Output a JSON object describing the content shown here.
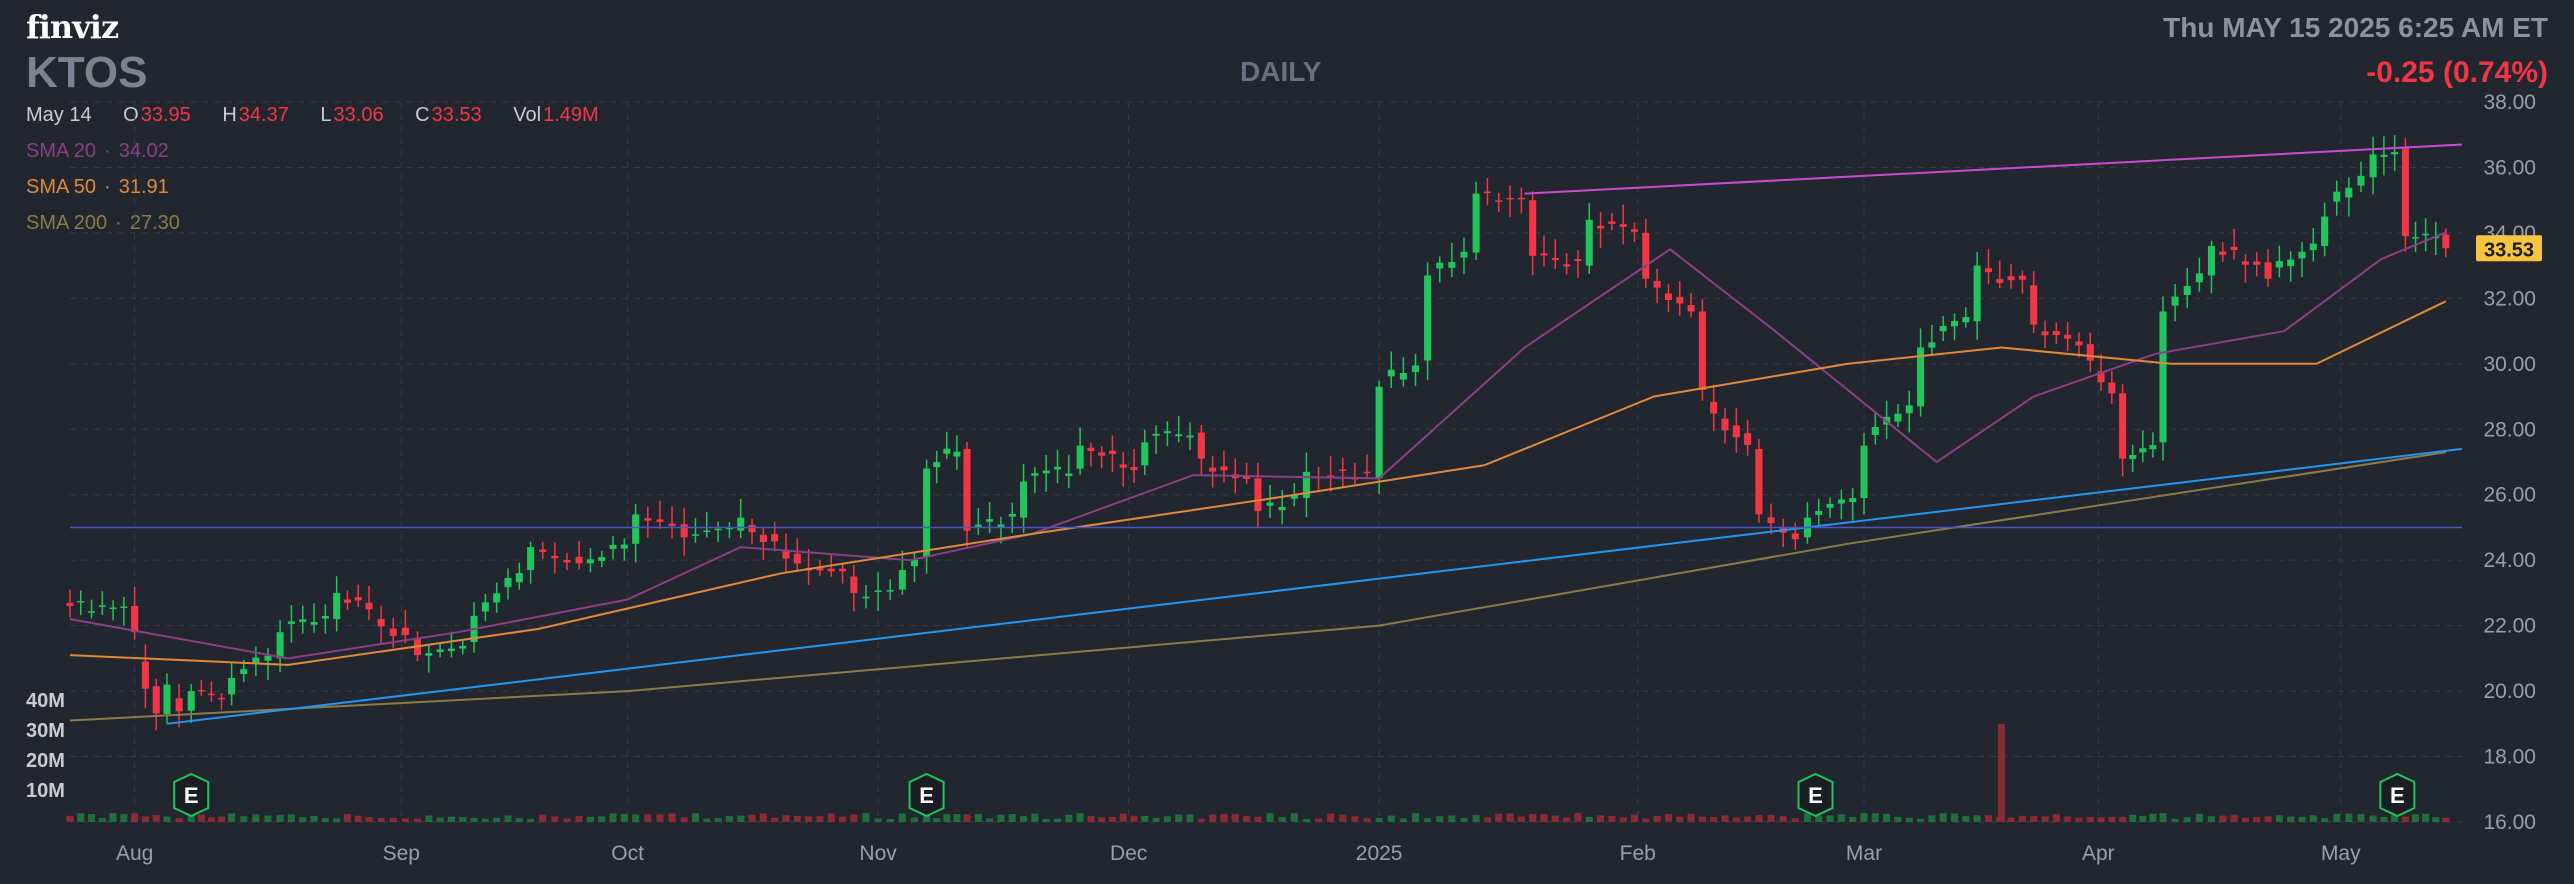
{
  "header": {
    "logo": "finviz",
    "ticker": "KTOS",
    "period": "DAILY",
    "datetime": "Thu MAY 15 2025 6:25 AM ET",
    "change": "-0.25 (0.74%)"
  },
  "ohlc": {
    "date": "May 14",
    "open_label": "O",
    "open": "33.95",
    "high_label": "H",
    "high": "34.37",
    "low_label": "L",
    "low": "33.06",
    "close_label": "C",
    "close": "33.53",
    "vol_label": "Vol",
    "vol": "1.49M"
  },
  "sma": [
    {
      "label": "SMA 20",
      "value": "34.02",
      "color": "#8a3f86"
    },
    {
      "label": "SMA 50",
      "value": "31.91",
      "color": "#e08a3a"
    },
    {
      "label": "SMA 200",
      "value": "27.30",
      "color": "#8c7a48"
    }
  ],
  "volume_axis": [
    "40M",
    "30M",
    "20M",
    "10M"
  ],
  "colors": {
    "up": "#21c45d",
    "down": "#f23645",
    "grid": "#363b46",
    "trend_upper": "#c94ad8",
    "trend_lower": "#2196f3",
    "hline": "#4c55c6",
    "price_tag_bg": "#f5c542",
    "axis_text": "#9aa0ab",
    "earnings": "#21c45d"
  },
  "chart_data": {
    "type": "candlestick",
    "ylim": [
      16,
      38
    ],
    "y_ticks": [
      "16.00",
      "18.00",
      "20.00",
      "22.00",
      "24.00",
      "26.00",
      "28.00",
      "30.00",
      "32.00",
      "34.00",
      "36.00",
      "38.00"
    ],
    "x_ticks": [
      {
        "label": "Aug",
        "date": "2024-08-01"
      },
      {
        "label": "Sep",
        "date": "2024-09-03"
      },
      {
        "label": "Oct",
        "date": "2024-10-01"
      },
      {
        "label": "Nov",
        "date": "2024-11-01"
      },
      {
        "label": "Dec",
        "date": "2024-12-02"
      },
      {
        "label": "2025",
        "date": "2025-01-02"
      },
      {
        "label": "Feb",
        "date": "2025-02-03"
      },
      {
        "label": "Mar",
        "date": "2025-03-03"
      },
      {
        "label": "Apr",
        "date": "2025-04-01"
      },
      {
        "label": "May",
        "date": "2025-05-01"
      }
    ],
    "last_price": "33.53",
    "earnings_label": "E",
    "earnings_dates": [
      "2024-08-08",
      "2024-11-07",
      "2025-02-25",
      "2025-05-08"
    ],
    "candles": [
      [
        "2024-07-24",
        22.7,
        22.6
      ],
      [
        "2024-08-01",
        22.6,
        21.8
      ],
      [
        "2024-08-05",
        19.3,
        20.2
      ],
      [
        "2024-08-08",
        19.4,
        20.0
      ],
      [
        "2024-08-13",
        19.9,
        20.4
      ],
      [
        "2024-08-19",
        21.0,
        21.8
      ],
      [
        "2024-08-26",
        22.2,
        23.0
      ],
      [
        "2024-08-30",
        22.7,
        22.5
      ],
      [
        "2024-09-05",
        21.6,
        21.1
      ],
      [
        "2024-09-12",
        21.5,
        22.3
      ],
      [
        "2024-09-19",
        23.7,
        24.4
      ],
      [
        "2024-09-25",
        24.1,
        23.9
      ],
      [
        "2024-10-02",
        24.5,
        25.4
      ],
      [
        "2024-10-08",
        25.1,
        24.7
      ],
      [
        "2024-10-15",
        24.9,
        25.3
      ],
      [
        "2024-10-22",
        24.2,
        23.9
      ],
      [
        "2024-10-29",
        23.5,
        23.0
      ],
      [
        "2024-11-04",
        23.1,
        23.7
      ],
      [
        "2024-11-07",
        24.1,
        26.8
      ],
      [
        "2024-11-12",
        27.4,
        24.9
      ],
      [
        "2024-11-19",
        25.3,
        26.4
      ],
      [
        "2024-11-26",
        26.8,
        27.5
      ],
      [
        "2024-12-04",
        26.9,
        27.6
      ],
      [
        "2024-12-11",
        27.9,
        27.1
      ],
      [
        "2024-12-18",
        26.5,
        25.5
      ],
      [
        "2024-12-24",
        25.9,
        26.7
      ],
      [
        "2025-01-02",
        26.5,
        29.3
      ],
      [
        "2025-01-08",
        30.1,
        32.7
      ],
      [
        "2025-01-14",
        33.4,
        35.2
      ],
      [
        "2025-01-21",
        35.0,
        33.3
      ],
      [
        "2025-01-28",
        33.0,
        34.4
      ],
      [
        "2025-02-04",
        34.0,
        32.6
      ],
      [
        "2025-02-11",
        31.6,
        29.2
      ],
      [
        "2025-02-18",
        27.4,
        25.4
      ],
      [
        "2025-02-24",
        24.7,
        25.3
      ],
      [
        "2025-03-03",
        25.9,
        27.5
      ],
      [
        "2025-03-10",
        28.7,
        30.5
      ],
      [
        "2025-03-17",
        31.3,
        33.0
      ],
      [
        "2025-03-24",
        32.4,
        31.2
      ],
      [
        "2025-03-31",
        30.6,
        30.1
      ],
      [
        "2025-04-04",
        29.1,
        27.1
      ],
      [
        "2025-04-09",
        27.6,
        31.6
      ],
      [
        "2025-04-15",
        32.7,
        33.6
      ],
      [
        "2025-04-22",
        33.1,
        32.6
      ],
      [
        "2025-04-29",
        33.6,
        34.5
      ],
      [
        "2025-05-05",
        35.7,
        36.4
      ],
      [
        "2025-05-09",
        36.6,
        33.9
      ],
      [
        "2025-05-14",
        33.95,
        33.53
      ]
    ],
    "volume_spike": {
      "date": "2025-03-20",
      "value": 40000000
    },
    "sma_lines": [
      {
        "name": "SMA 20",
        "points": [
          [
            "2024-07-24",
            22.2
          ],
          [
            "2024-08-20",
            21.0
          ],
          [
            "2024-09-10",
            21.8
          ],
          [
            "2024-10-01",
            22.8
          ],
          [
            "2024-10-15",
            24.4
          ],
          [
            "2024-11-05",
            24.0
          ],
          [
            "2024-11-20",
            24.8
          ],
          [
            "2024-12-10",
            26.6
          ],
          [
            "2025-01-02",
            26.5
          ],
          [
            "2025-01-20",
            30.5
          ],
          [
            "2025-02-07",
            33.5
          ],
          [
            "2025-02-20",
            31.0
          ],
          [
            "2025-03-12",
            27.0
          ],
          [
            "2025-03-24",
            29.0
          ],
          [
            "2025-04-08",
            30.3
          ],
          [
            "2025-04-24",
            31.0
          ],
          [
            "2025-05-06",
            33.2
          ],
          [
            "2025-05-14",
            34.02
          ]
        ]
      },
      {
        "name": "SMA 50",
        "points": [
          [
            "2024-07-24",
            21.1
          ],
          [
            "2024-08-20",
            20.8
          ],
          [
            "2024-09-20",
            21.9
          ],
          [
            "2024-10-20",
            23.6
          ],
          [
            "2024-11-20",
            24.8
          ],
          [
            "2024-12-20",
            25.9
          ],
          [
            "2025-01-15",
            26.9
          ],
          [
            "2025-02-05",
            29.0
          ],
          [
            "2025-03-01",
            30.0
          ],
          [
            "2025-03-20",
            30.5
          ],
          [
            "2025-04-10",
            30.0
          ],
          [
            "2025-04-28",
            30.0
          ],
          [
            "2025-05-14",
            31.91
          ]
        ]
      },
      {
        "name": "SMA 200",
        "points": [
          [
            "2024-07-24",
            19.1
          ],
          [
            "2024-10-01",
            20.0
          ],
          [
            "2025-01-02",
            22.0
          ],
          [
            "2025-03-01",
            24.5
          ],
          [
            "2025-05-14",
            27.3
          ]
        ]
      }
    ],
    "trendlines": [
      {
        "kind": "upper",
        "from": [
          "2025-01-20",
          35.2
        ],
        "to": [
          "2025-05-16",
          36.7
        ]
      },
      {
        "kind": "lower",
        "from": [
          "2024-08-05",
          19.0
        ],
        "to": [
          "2025-05-16",
          27.4
        ]
      },
      {
        "kind": "horizontal",
        "value": 25.0
      }
    ]
  }
}
